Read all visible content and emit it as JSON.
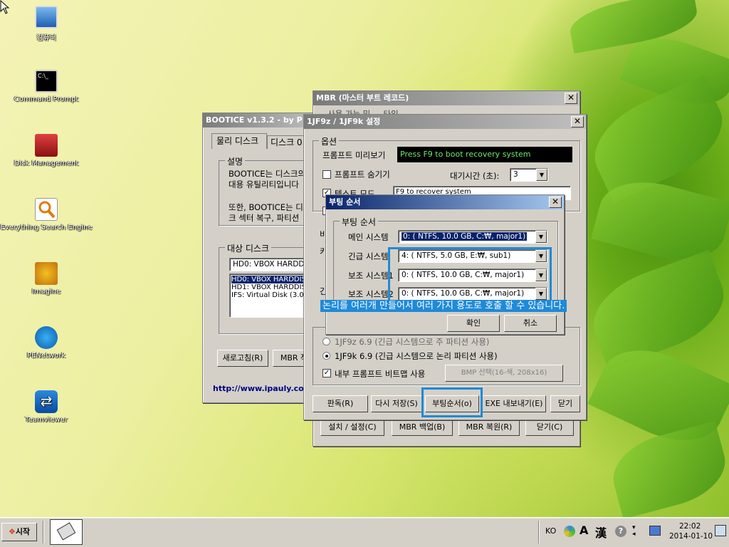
{
  "desktop": {
    "icons": [
      {
        "label": "컴퓨터",
        "icon": "computer-icon"
      },
      {
        "label": "Command Prompt",
        "icon": "command-prompt-icon"
      },
      {
        "label": "Disk Management",
        "icon": "disk-management-icon"
      },
      {
        "label": "Everything Search Engine",
        "icon": "everything-search-icon"
      },
      {
        "label": "Imagine",
        "icon": "imagine-icon"
      },
      {
        "label": "PENetwork",
        "icon": "network-icon"
      },
      {
        "label": "Teamviewer",
        "icon": "teamviewer-icon"
      }
    ]
  },
  "bootice": {
    "title": "BOOTICE v1.3.2 - by P",
    "tabs": [
      "물리 디스크",
      "디스크 0"
    ],
    "desc_group": "설명",
    "desc_line1": "BOOTICE는 디스크의",
    "desc_line2": "대용 유틸리티입니다",
    "desc_line3": "또한, BOOTICE는 디",
    "desc_line4": "크 섹터 복구, 파티션",
    "target_group": "대상 디스크",
    "combo_value": "HD0: VBOX HARDDIS",
    "list": [
      "HD0: VBOX HARDDIS",
      "HD1: VBOX HARDDIS",
      "IFS: Virtual Disk (3.0"
    ],
    "refresh_button": "새로고침(R)",
    "mbr_button": "MBR 작",
    "url": "http://www.ipauly.com"
  },
  "mbr": {
    "title": "MBR (마스터 부트 레코드)",
    "partial_text": "사용 가능 및 ... 타입",
    "buttons": [
      "설치 / 설정(C)",
      "MBR 백업(B)",
      "MBR 복원(R)",
      "닫기(C)"
    ]
  },
  "config": {
    "title": "1JF9z / 1JF9k 설정",
    "options_group": "옵션",
    "preview_label": "프롬프트 미리보기",
    "preview_text": "Press F9 to boot recovery system",
    "hide_prompt": "프롬프트 숨기기",
    "timeout_label": "대기시간 (초):",
    "timeout_value": "3",
    "text_mode": "텍스트 모드",
    "text_value": "F9 to recover system",
    "side_b": "비",
    "side_k": "키",
    "side_g": "긴",
    "radio_1jf9k": "1JF9k 6.9 (긴급 시스템으로 논리 파티션 사용)",
    "radio_partial": "1JF9z 6.9 (긴급 시스템으로 주 파티션 사용)",
    "bitmap_label": "내부 프롬프트 비트맵 사용",
    "bmp_button": "BMP 선택(16-색, 208x16)",
    "buttons": [
      "판독(R)",
      "다시 저장(S)",
      "부팅순서(o)",
      "EXE 내보내기(E)",
      "닫기"
    ]
  },
  "boot_order": {
    "title": "부팅 순서",
    "group": "부팅 순서",
    "rows": [
      {
        "label": "메인 시스템",
        "value": "0: ( NTFS,  10.0 GB, C:₩, major1)"
      },
      {
        "label": "긴급 시스템",
        "value": "4: ( NTFS,   5.0 GB, E:₩, sub1)"
      },
      {
        "label": "보조 시스템1",
        "value": "0: ( NTFS,  10.0 GB, C:₩, major1)"
      },
      {
        "label": "보조 시스템2",
        "value": "0: ( NTFS,  10.0 GB, C:₩, major1)"
      }
    ],
    "ok": "확인",
    "cancel": "취소"
  },
  "annotation": "논리를 여러개 만들어서 여러 가지 용도로 호출 할 수 있습니다.",
  "taskbar": {
    "start": "시작",
    "lang": "KO",
    "ime1": "A",
    "ime2": "漢",
    "time": "22:02",
    "date": "2014-01-10"
  },
  "colors": {
    "highlight": "#1f8ad8",
    "titlebar_active": "#0a246a"
  }
}
